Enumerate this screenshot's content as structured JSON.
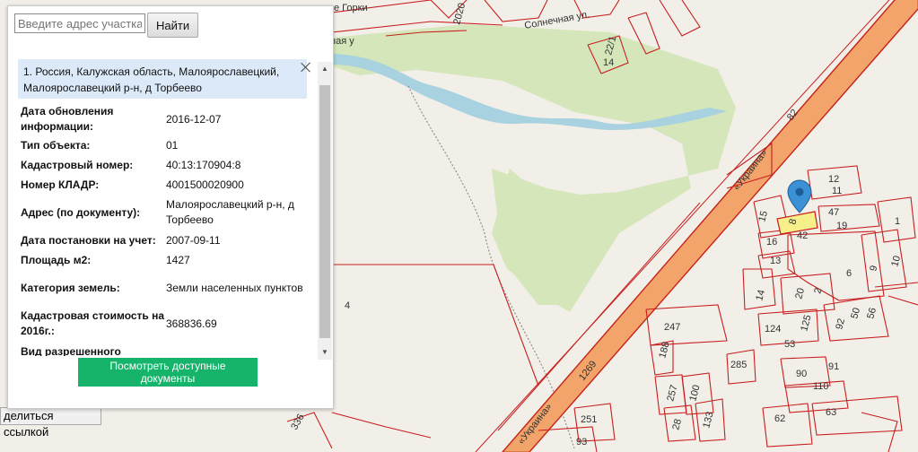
{
  "search": {
    "placeholder": "Введите адрес участка",
    "value": "",
    "button_label": "Найти"
  },
  "result": {
    "title": "1. Россия, Калужская область, Малоярославецкий, Малоярославецкий р-н, д Торбеево"
  },
  "fields": [
    {
      "label": "Дата обновления информации:",
      "value": "2016-12-07"
    },
    {
      "label": "Тип объекта:",
      "value": "01"
    },
    {
      "label": "Кадастровый номер:",
      "value": "40:13:170904:8"
    },
    {
      "label": "Номер КЛАДР:",
      "value": "4001500020900"
    },
    {
      "label": "Адрес (по документу):",
      "value": "Малоярославецкий р-н, д Торбеево"
    },
    {
      "label": "Дата постановки на учет:",
      "value": "2007-09-11"
    },
    {
      "label": "Площадь м2:",
      "value": "1427"
    },
    {
      "label": "Категория земель:",
      "value": "Земли населенных пунктов"
    },
    {
      "label": "Кадастровая стоимость на 2016г.:",
      "value": "368836.69"
    },
    {
      "label": "Вид разрешенного",
      "value": ""
    }
  ],
  "docs_button_label": "Посмотреть доступные документы",
  "share_button_label": "делиться ссылкой",
  "map": {
    "street_labels": [
      "е Горки",
      "2020",
      "Солнечная ул.",
      "ная у",
      "«Украина»",
      "«Украина»",
      "82",
      "1269"
    ],
    "parcel_labels": [
      "22/1",
      "14",
      "12",
      "11",
      "47",
      "19",
      "15",
      "8",
      "16",
      "42",
      "1",
      "13",
      "6",
      "9",
      "10",
      "14",
      "20",
      "2",
      "124",
      "125",
      "92",
      "50",
      "56",
      "53",
      "247",
      "188",
      "285",
      "90",
      "91",
      "110",
      "100",
      "257",
      "28",
      "133",
      "251",
      "93",
      "62",
      "63",
      "336",
      "4"
    ],
    "colors": {
      "road": "#f2a46b",
      "road_edge": "#d06e35",
      "forest": "#d2e5b5",
      "water": "#a5d0e0",
      "parcel": "#c71f1f",
      "selected": "#f7ef8a",
      "marker": "#3b91d6"
    }
  }
}
